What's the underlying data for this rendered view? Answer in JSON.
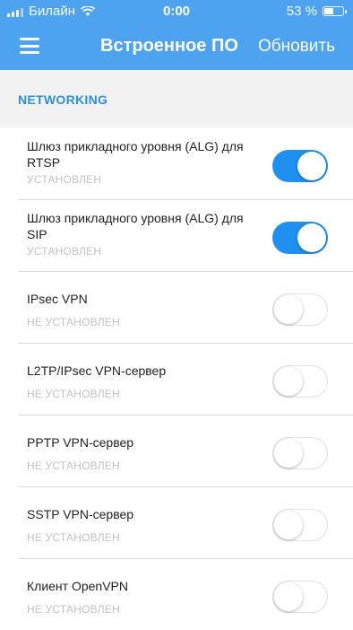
{
  "status_bar": {
    "carrier": "Билайн",
    "time": "0:00",
    "battery": "53 %",
    "battery_level": 0.53
  },
  "nav": {
    "title": "Встроенное ПО",
    "action": "Обновить",
    "menu_icon": "hamburger-icon"
  },
  "section": {
    "title": "NETWORKING"
  },
  "items": [
    {
      "label": "Шлюз прикладного уровня (ALG) для RTSP",
      "status": "УСТАНОВЛЕН",
      "enabled": true
    },
    {
      "label": "Шлюз прикладного уровня (ALG) для SIP",
      "status": "УСТАНОВЛЕН",
      "enabled": true
    },
    {
      "label": "IPsec VPN",
      "status": "НЕ УСТАНОВЛЕН",
      "enabled": false
    },
    {
      "label": "L2TP/IPsec VPN-сервер",
      "status": "НЕ УСТАНОВЛЕН",
      "enabled": false
    },
    {
      "label": "PPTP VPN-сервер",
      "status": "НЕ УСТАНОВЛЕН",
      "enabled": false
    },
    {
      "label": "SSTP VPN-сервер",
      "status": "НЕ УСТАНОВЛЕН",
      "enabled": false
    },
    {
      "label": "Клиент OpenVPN",
      "status": "НЕ УСТАНОВЛЕН",
      "enabled": false
    }
  ],
  "colors": {
    "header": "#4da3ef",
    "accent": "#2a90e0",
    "toggle_on": "#1f8ff0"
  }
}
